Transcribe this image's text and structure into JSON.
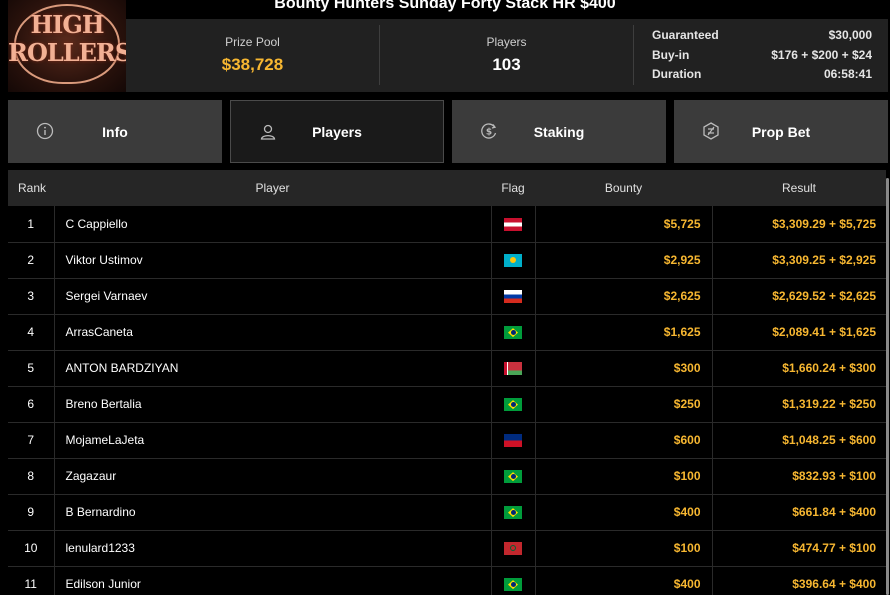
{
  "tournament": {
    "title": "Bounty Hunters Sunday Forty Stack HR $400",
    "logo_text_line1": "HIGH",
    "logo_text_line2": "ROLLERS"
  },
  "stats": {
    "prize_pool_label": "Prize Pool",
    "prize_pool_value": "$38,728",
    "players_label": "Players",
    "players_value": "103",
    "details": [
      {
        "label": "Guaranteed",
        "value": "$30,000"
      },
      {
        "label": "Buy-in",
        "value": "$176 + $200 + $24"
      },
      {
        "label": "Duration",
        "value": "06:58:41"
      }
    ]
  },
  "tabs": [
    {
      "label": "Info",
      "icon": "info-icon"
    },
    {
      "label": "Players",
      "icon": "user-icon",
      "active": true
    },
    {
      "label": "Staking",
      "icon": "staking-icon"
    },
    {
      "label": "Prop Bet",
      "icon": "prop-bet-icon"
    }
  ],
  "table": {
    "headers": {
      "rank": "Rank",
      "player": "Player",
      "flag": "Flag",
      "bounty": "Bounty",
      "result": "Result"
    },
    "rows": [
      {
        "rank": "1",
        "player": "C Cappiello",
        "flag": "austria",
        "bounty": "$5,725",
        "result": "$3,309.29 + $5,725"
      },
      {
        "rank": "2",
        "player": "Viktor Ustimov",
        "flag": "kazakhstan",
        "bounty": "$2,925",
        "result": "$3,309.25 + $2,925"
      },
      {
        "rank": "3",
        "player": "Sergei Varnaev",
        "flag": "russia",
        "bounty": "$2,625",
        "result": "$2,629.52 + $2,625"
      },
      {
        "rank": "4",
        "player": "ArrasCaneta",
        "flag": "brazil",
        "bounty": "$1,625",
        "result": "$2,089.41 + $1,625"
      },
      {
        "rank": "5",
        "player": "ANTON BARDZIYAN",
        "flag": "belarus",
        "bounty": "$300",
        "result": "$1,660.24 + $300"
      },
      {
        "rank": "6",
        "player": "Breno Bertalia",
        "flag": "brazil",
        "bounty": "$250",
        "result": "$1,319.22 + $250"
      },
      {
        "rank": "7",
        "player": "MojameLaJeta",
        "flag": "liechtenstein",
        "bounty": "$600",
        "result": "$1,048.25 + $600"
      },
      {
        "rank": "8",
        "player": "Zagazaur",
        "flag": "brazil",
        "bounty": "$100",
        "result": "$832.93 + $100"
      },
      {
        "rank": "9",
        "player": "B Bernardino",
        "flag": "brazil",
        "bounty": "$400",
        "result": "$661.84 + $400"
      },
      {
        "rank": "10",
        "player": "lenulard1233",
        "flag": "morocco",
        "bounty": "$100",
        "result": "$474.77 + $100"
      },
      {
        "rank": "11",
        "player": "Edilson Junior",
        "flag": "brazil",
        "bounty": "$400",
        "result": "$396.64 + $400"
      }
    ]
  },
  "colors": {
    "accent": "#f7b731",
    "panel": "#212121",
    "tab": "#3b3b3b"
  }
}
